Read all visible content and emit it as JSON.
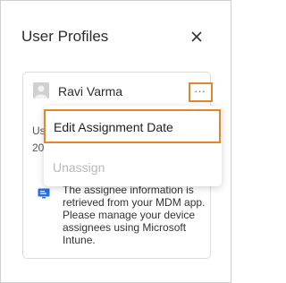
{
  "panel": {
    "title": "User Profiles",
    "close_icon": "close-icon"
  },
  "card": {
    "user_name": "Ravi Varma",
    "avatar_icon": "user-avatar-icon",
    "more_label": "···",
    "partial_line_1": "Us",
    "partial_line_2": "20",
    "info_icon": "info-screen-icon",
    "info_text_visible": "The assignee information is retrieved from your MDM app. Please manage your device assignees using Microsoft Intune."
  },
  "menu": {
    "items": [
      {
        "label": "Edit Assignment Date",
        "enabled": true
      },
      {
        "label": "Unassign",
        "enabled": false
      }
    ]
  },
  "colors": {
    "focus_outline": "#e8832a",
    "disabled_text": "#b8b8b8",
    "info_icon": "#2a6fdb"
  }
}
